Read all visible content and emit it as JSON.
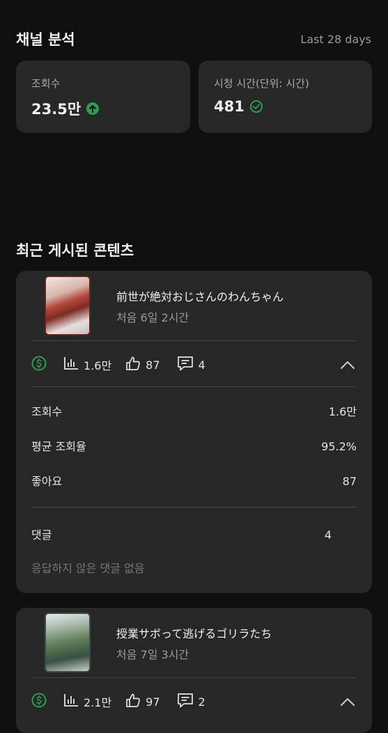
{
  "header": {
    "title": "채널 분석",
    "period": "Last 28 days"
  },
  "stats": {
    "views": {
      "label": "조회수",
      "value": "23.5만"
    },
    "watch_time": {
      "label": "시청 시간(단위: 시간)",
      "value": "481"
    }
  },
  "recent": {
    "title": "최근 게시된 콘텐츠",
    "items": [
      {
        "title": "前世が絶対おじさんのわんちゃん",
        "subtitle": "처음 6일 2시간",
        "views": "1.6만",
        "likes": "87",
        "comments": "4",
        "details": {
          "views_label": "조회수",
          "views_value": "1.6만",
          "avg_label": "평균 조회율",
          "avg_value": "95.2%",
          "likes_label": "좋아요",
          "likes_value": "87",
          "comments_label": "댓글",
          "comments_value": "4",
          "reply_note": "응답하지 않은 댓글 없음"
        }
      },
      {
        "title": "授業サボって逃げるゴリラたち",
        "subtitle": "처음 7일 3시간",
        "views": "2.1만",
        "likes": "97",
        "comments": "2"
      }
    ]
  },
  "colors": {
    "background": "#0f0f0f",
    "card": "#272727",
    "accent": "#2e9c55"
  },
  "icons": [
    "arrow-up-icon",
    "check-circle-icon",
    "dollar-icon",
    "bar-chart-icon",
    "thumbs-up-icon",
    "comment-icon",
    "chevron-up-icon"
  ]
}
